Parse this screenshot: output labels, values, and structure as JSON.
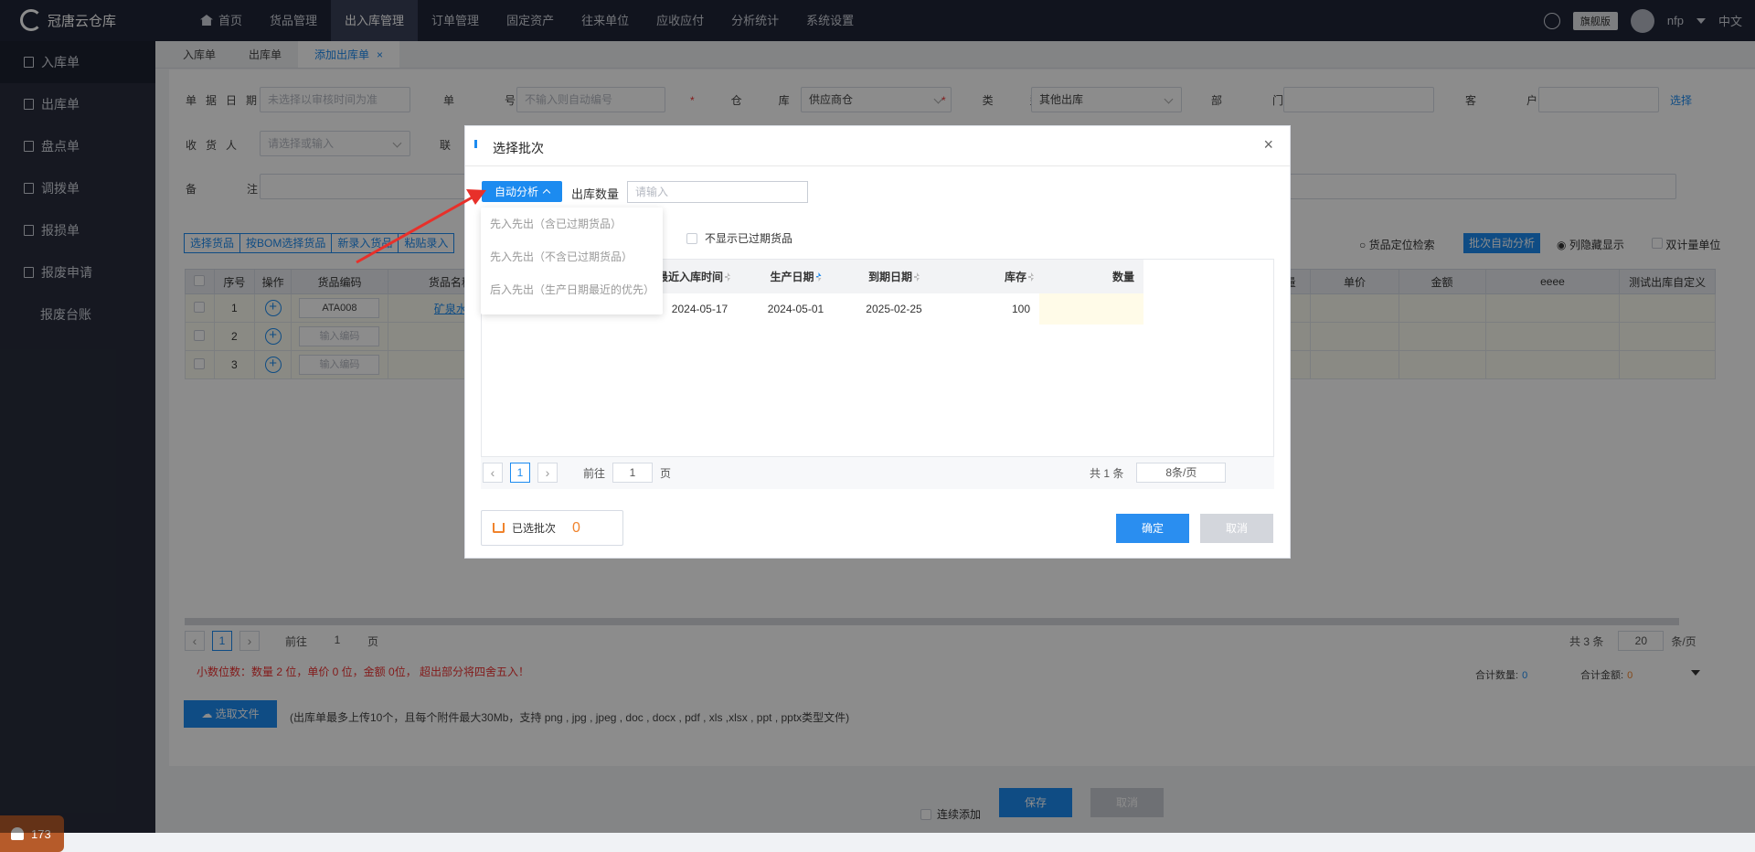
{
  "app": {
    "name": "冠唐云仓库"
  },
  "topnav": {
    "items": [
      "首页",
      "货品管理",
      "出入库管理",
      "订单管理",
      "固定资产",
      "往来单位",
      "应收应付",
      "分析统计",
      "系统设置"
    ],
    "edition": "旗舰版",
    "user": "nfp",
    "lang": "中文"
  },
  "sidebar": {
    "items": [
      "入库单",
      "出库单",
      "盘点单",
      "调拨单",
      "报损单",
      "报废申请",
      "报废台账"
    ],
    "notif_count": "173"
  },
  "tabs": [
    "入库单",
    "出库单",
    "添加出库单"
  ],
  "form": {
    "date_label": "单据日期",
    "date_ph": "未选择以审核时间为准",
    "no_label": "单号",
    "no_ph": "不输入则自动编号",
    "wh_label": "仓库",
    "wh_value": "供应商仓",
    "type_label": "类型",
    "type_value": "其他出库",
    "dept_label": "部门",
    "customer_label": "客户",
    "select_link": "选择",
    "receiver_label": "收货人",
    "receiver_ph": "请选择或输入",
    "contact_label": "联",
    "remark_label": "备注"
  },
  "toolbar": {
    "buttons": [
      "选择货品",
      "按BOM选择货品",
      "新录入货品",
      "粘贴录入"
    ],
    "locate": "货品定位检索",
    "batch_auto": "批次自动分析",
    "col_hide": "列隐藏显示",
    "dual_unit": "双计量单位"
  },
  "table": {
    "headers": [
      "序号",
      "操作",
      "货品编码",
      "货品名称",
      "量",
      "单价",
      "金额",
      "eeee",
      "测试出库自定义"
    ],
    "rows": [
      {
        "no": "1",
        "code": "ATA008",
        "name": "矿泉水"
      },
      {
        "no": "2",
        "code": "输入编码",
        "name": ""
      },
      {
        "no": "3",
        "code": "输入编码",
        "name": ""
      }
    ]
  },
  "pager": {
    "page": "1",
    "goto": "前往",
    "page_unit": "页",
    "total": "共 3 条",
    "size": "20",
    "size_unit": "条/页"
  },
  "hint": "小数位数：数量 2 位，单价 0 位，金额 0位， 超出部分将四舍五入！",
  "totals": {
    "qty_label": "合计数量:",
    "qty": "0",
    "amt_label": "合计金额:",
    "amt": "0"
  },
  "upload": {
    "label": "选取文件",
    "note": "(出库单最多上传10个，且每个附件最大30Mb，支持 png , jpg , jpeg , doc , docx , pdf , xls ,xlsx , ppt , pptx类型文件)"
  },
  "footer": {
    "continue": "连续添加",
    "save": "保存",
    "cancel": "取消"
  },
  "modal": {
    "title": "选择批次",
    "auto_btn": "自动分析",
    "qty_label": "出库数量",
    "qty_ph": "请输入",
    "options": [
      "先入先出（含已过期货品）",
      "先入先出（不含已过期货品）",
      "后入先出（生产日期最近的优先）"
    ],
    "hide_expired": "不显示已过期货品",
    "headers": [
      "最近入库时间",
      "生产日期",
      "到期日期",
      "库存",
      "数量"
    ],
    "rows": [
      {
        "recent": "2024-05-17",
        "prod": "2024-05-01",
        "exp": "2025-02-25",
        "stock": "100",
        "qty": ""
      }
    ],
    "pager": {
      "page": "1",
      "goto": "前往",
      "goto_val": "1",
      "page_unit": "页",
      "total": "共 1 条",
      "size": "8条/页"
    },
    "selected_label": "已选批次",
    "selected_count": "0",
    "ok": "确定",
    "cancel": "取消"
  },
  "colors": {
    "primary": "#1c8bf0",
    "topbar": "#202537",
    "sidebar": "#282d3d",
    "arrow": "#e8302a"
  }
}
